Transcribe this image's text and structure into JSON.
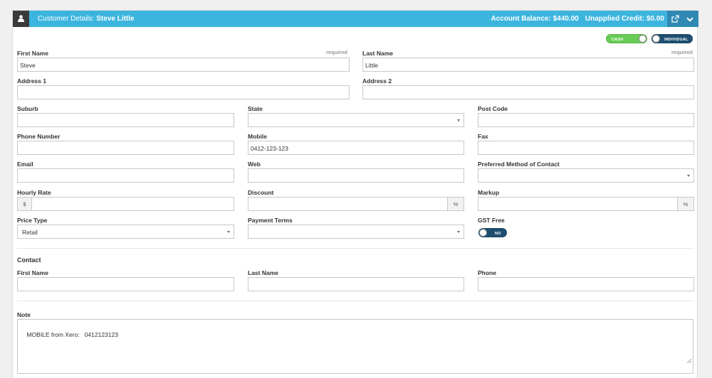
{
  "header": {
    "prefix": "Customer Details:",
    "customer_name": "Steve Little",
    "account_balance": "Account Balance: $440.00",
    "unapplied_credit": "Unapplied Credit: $0.00",
    "icons": [
      "user-icon",
      "external-link-icon",
      "chevron-down-icon"
    ]
  },
  "toggles": {
    "payment_mode": "CASH",
    "customer_type": "INDIVIDUAL",
    "gst_free": "NO"
  },
  "required_label": "required",
  "labels": {
    "first_name": "First Name",
    "last_name": "Last Name",
    "address1": "Address 1",
    "address2": "Address 2",
    "suburb": "Suburb",
    "state": "State",
    "post_code": "Post Code",
    "phone": "Phone Number",
    "mobile": "Mobile",
    "fax": "Fax",
    "email": "Email",
    "web": "Web",
    "preferred_contact": "Preferred Method of Contact",
    "hourly_rate": "Hourly Rate",
    "discount": "Discount",
    "markup": "Markup",
    "price_type": "Price Type",
    "payment_terms": "Payment Terms",
    "gst_free": "GST Free",
    "note": "Note"
  },
  "values": {
    "first_name": "Steve",
    "last_name": "Little",
    "address1": "",
    "address2": "",
    "suburb": "",
    "state": "",
    "post_code": "",
    "phone": "",
    "mobile": "0412-123-123",
    "fax": "",
    "email": "",
    "web": "",
    "preferred_contact": "",
    "hourly_rate": "",
    "discount": "",
    "markup": "",
    "price_type": "Retail",
    "payment_terms": "",
    "note": "MOBILE from Xero:   0412123123"
  },
  "addons": {
    "currency": "$",
    "percent": "%"
  },
  "contact": {
    "section_title": "Contact",
    "first_name_label": "First Name",
    "last_name_label": "Last Name",
    "phone_label": "Phone",
    "first_name": "",
    "last_name": "",
    "phone": ""
  },
  "colors": {
    "header_bg": "#3cb5de",
    "header_actions_bg": "#2f89b3",
    "cash_toggle": "#68cc56",
    "dark_toggle": "#1e4f70"
  }
}
